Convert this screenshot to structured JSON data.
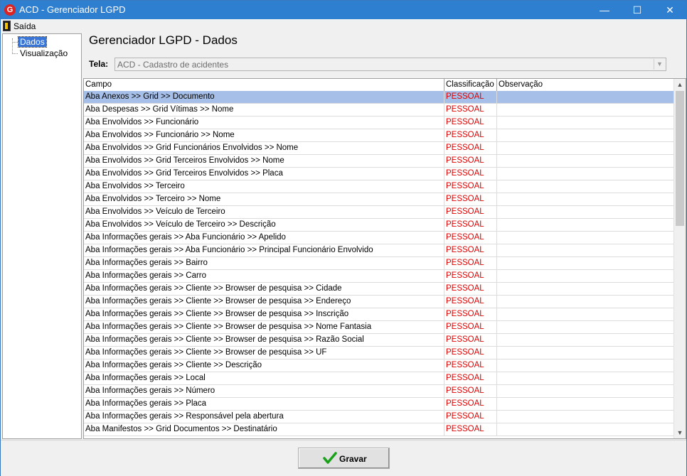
{
  "window": {
    "title": "ACD - Gerenciador LGPD",
    "app_icon_letter": "G",
    "minimize_glyph": "—",
    "maximize_glyph": "☐",
    "close_glyph": "✕"
  },
  "menu": {
    "exit_label": "Saída"
  },
  "tree": {
    "items": [
      "Dados",
      "Visualização"
    ],
    "selected": "Dados"
  },
  "heading": "Gerenciador LGPD - Dados",
  "tela": {
    "label": "Tela:",
    "value": "ACD - Cadastro de acidentes"
  },
  "grid": {
    "columns": [
      "Campo",
      "Classificação",
      "Observação"
    ],
    "selected_row": 0,
    "rows": [
      {
        "campo": "Aba Anexos >> Grid >> Documento",
        "classificacao": "PESSOAL",
        "observacao": ""
      },
      {
        "campo": "Aba Despesas >> Grid Vítimas >> Nome",
        "classificacao": "PESSOAL",
        "observacao": ""
      },
      {
        "campo": "Aba Envolvidos >> Funcionário",
        "classificacao": "PESSOAL",
        "observacao": ""
      },
      {
        "campo": "Aba Envolvidos >> Funcionário >> Nome",
        "classificacao": "PESSOAL",
        "observacao": ""
      },
      {
        "campo": "Aba Envolvidos >> Grid Funcionários Envolvidos >> Nome",
        "classificacao": "PESSOAL",
        "observacao": ""
      },
      {
        "campo": "Aba Envolvidos >> Grid Terceiros Envolvidos >> Nome",
        "classificacao": "PESSOAL",
        "observacao": ""
      },
      {
        "campo": "Aba Envolvidos >> Grid Terceiros Envolvidos >> Placa",
        "classificacao": "PESSOAL",
        "observacao": ""
      },
      {
        "campo": "Aba Envolvidos >> Terceiro",
        "classificacao": "PESSOAL",
        "observacao": ""
      },
      {
        "campo": "Aba Envolvidos >> Terceiro >> Nome",
        "classificacao": "PESSOAL",
        "observacao": ""
      },
      {
        "campo": "Aba Envolvidos >> Veículo de Terceiro",
        "classificacao": "PESSOAL",
        "observacao": ""
      },
      {
        "campo": "Aba Envolvidos >> Veículo de Terceiro >> Descrição",
        "classificacao": "PESSOAL",
        "observacao": ""
      },
      {
        "campo": "Aba Informações gerais >> Aba Funcionário >> Apelido",
        "classificacao": "PESSOAL",
        "observacao": ""
      },
      {
        "campo": "Aba Informações gerais >> Aba Funcionário >> Principal Funcionário Envolvido",
        "classificacao": "PESSOAL",
        "observacao": ""
      },
      {
        "campo": "Aba Informações gerais >> Bairro",
        "classificacao": "PESSOAL",
        "observacao": ""
      },
      {
        "campo": "Aba Informações gerais >> Carro",
        "classificacao": "PESSOAL",
        "observacao": ""
      },
      {
        "campo": "Aba Informações gerais >> Cliente >> Browser de pesquisa >> Cidade",
        "classificacao": "PESSOAL",
        "observacao": ""
      },
      {
        "campo": "Aba Informações gerais >> Cliente >> Browser de pesquisa >> Endereço",
        "classificacao": "PESSOAL",
        "observacao": ""
      },
      {
        "campo": "Aba Informações gerais >> Cliente >> Browser de pesquisa >> Inscrição",
        "classificacao": "PESSOAL",
        "observacao": ""
      },
      {
        "campo": "Aba Informações gerais >> Cliente >> Browser de pesquisa >> Nome Fantasia",
        "classificacao": "PESSOAL",
        "observacao": ""
      },
      {
        "campo": "Aba Informações gerais >> Cliente >> Browser de pesquisa >> Razão Social",
        "classificacao": "PESSOAL",
        "observacao": ""
      },
      {
        "campo": "Aba Informações gerais >> Cliente >> Browser de pesquisa >> UF",
        "classificacao": "PESSOAL",
        "observacao": ""
      },
      {
        "campo": "Aba Informações gerais >> Cliente >> Descrição",
        "classificacao": "PESSOAL",
        "observacao": ""
      },
      {
        "campo": "Aba Informações gerais >> Local",
        "classificacao": "PESSOAL",
        "observacao": ""
      },
      {
        "campo": "Aba Informações gerais >> Número",
        "classificacao": "PESSOAL",
        "observacao": ""
      },
      {
        "campo": "Aba Informações gerais >> Placa",
        "classificacao": "PESSOAL",
        "observacao": ""
      },
      {
        "campo": "Aba Informações gerais >> Responsável pela abertura",
        "classificacao": "PESSOAL",
        "observacao": ""
      },
      {
        "campo": "Aba Manifestos >> Grid Documentos >> Destinatário",
        "classificacao": "PESSOAL",
        "observacao": ""
      }
    ]
  },
  "buttons": {
    "save_label": "Gravar"
  },
  "colors": {
    "titlebar": "#2f7fd0",
    "selected_row": "#a6bfe8",
    "classification_text": "#e00000",
    "tree_selection": "#3875d7",
    "check_icon": "#1aa11a"
  },
  "icons": {
    "app": "app-logo-icon",
    "exit": "exit-door-icon",
    "save": "checkmark-icon"
  }
}
